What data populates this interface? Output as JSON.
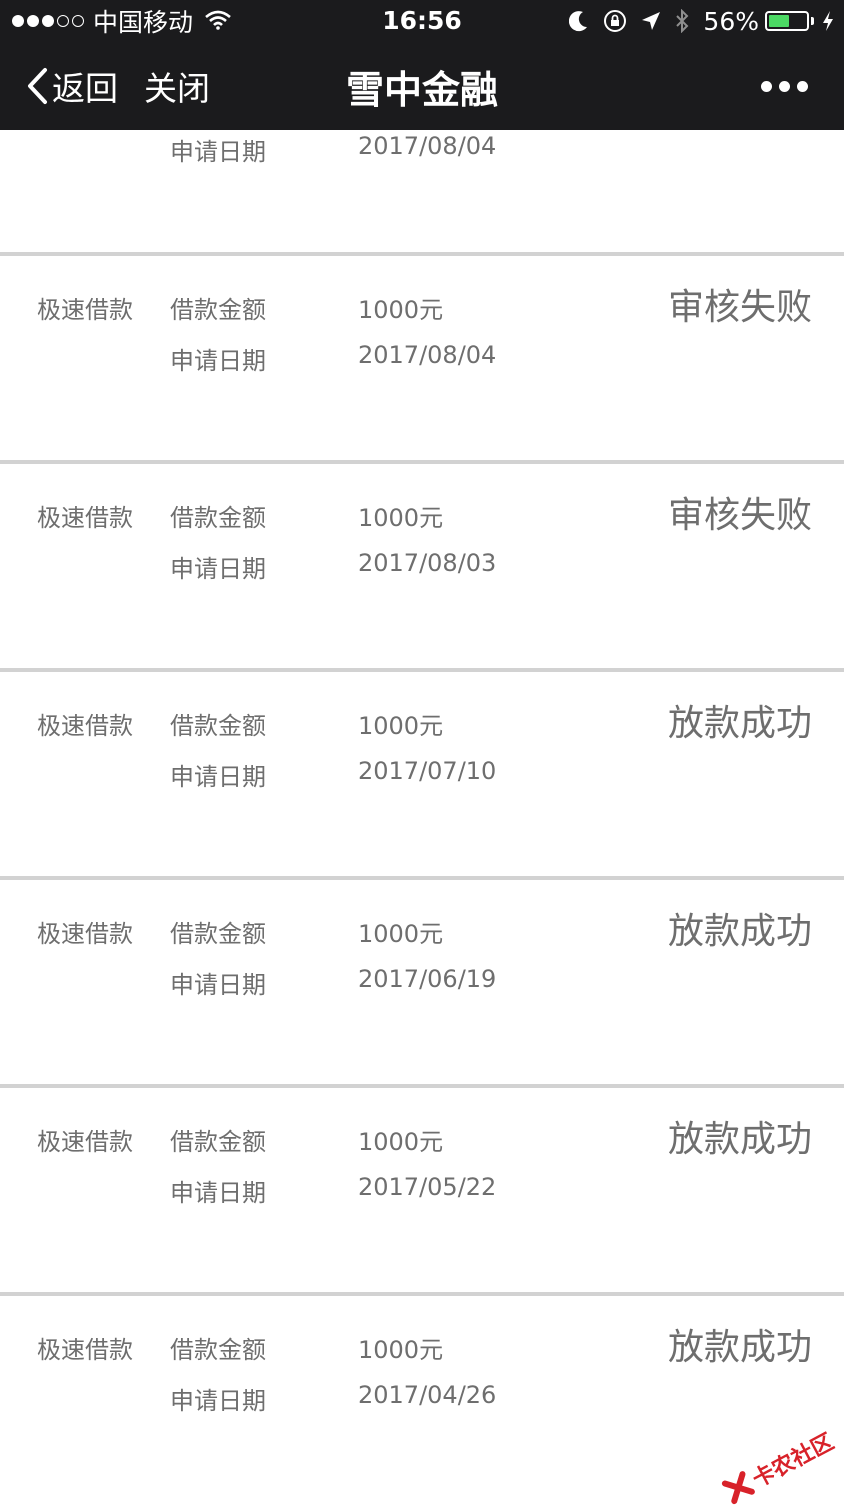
{
  "status_bar": {
    "carrier": "中国移动",
    "time": "16:56",
    "battery_percent": "56%",
    "battery_level": 0.56,
    "icons": [
      "signal-dots",
      "wifi-icon",
      "moon-icon",
      "rotation-lock-icon",
      "location-icon",
      "bluetooth-icon",
      "battery-icon",
      "charging-icon"
    ]
  },
  "nav": {
    "back_label": "返回",
    "close_label": "关闭",
    "title": "雪中金融",
    "more_icon": "more-dots-icon"
  },
  "partial_item": {
    "date_key": "申请日期",
    "date_value": "2017/08/04"
  },
  "loans": [
    {
      "type": "极速借款",
      "amount_key": "借款金额",
      "amount": "1000元",
      "date_key": "申请日期",
      "date": "2017/08/04",
      "status": "审核失败"
    },
    {
      "type": "极速借款",
      "amount_key": "借款金额",
      "amount": "1000元",
      "date_key": "申请日期",
      "date": "2017/08/03",
      "status": "审核失败"
    },
    {
      "type": "极速借款",
      "amount_key": "借款金额",
      "amount": "1000元",
      "date_key": "申请日期",
      "date": "2017/07/10",
      "status": "放款成功"
    },
    {
      "type": "极速借款",
      "amount_key": "借款金额",
      "amount": "1000元",
      "date_key": "申请日期",
      "date": "2017/06/19",
      "status": "放款成功"
    },
    {
      "type": "极速借款",
      "amount_key": "借款金额",
      "amount": "1000元",
      "date_key": "申请日期",
      "date": "2017/05/22",
      "status": "放款成功"
    },
    {
      "type": "极速借款",
      "amount_key": "借款金额",
      "amount": "1000元",
      "date_key": "申请日期",
      "date": "2017/04/26",
      "status": "放款成功"
    }
  ],
  "watermark": {
    "text": "卡农社区",
    "color": "#d8222a"
  },
  "colors": {
    "nav_background": "#1b1b1d",
    "text_gray": "#6e6e6e",
    "divider": "#d2d2d2",
    "battery_green": "#4cd964"
  }
}
